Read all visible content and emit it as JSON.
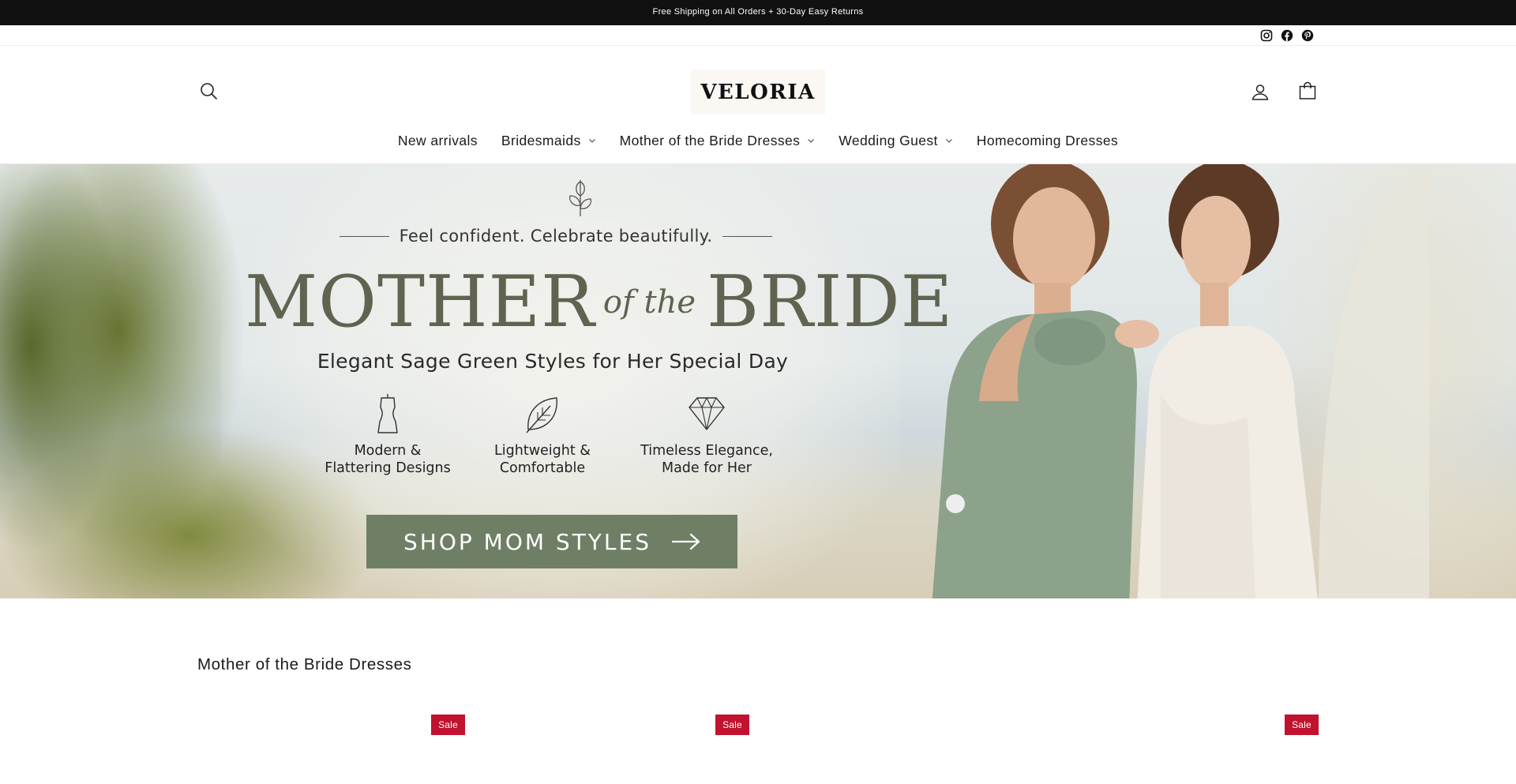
{
  "announcement": {
    "text": "Free Shipping on All Orders + 30-Day Easy Returns"
  },
  "social": [
    {
      "icon": "instagram-icon"
    },
    {
      "icon": "facebook-icon"
    },
    {
      "icon": "pinterest-icon"
    }
  ],
  "header": {
    "logo": "VELORIA",
    "search_icon": "search-icon",
    "account_icon": "account-icon",
    "cart_icon": "shopping-bag-icon"
  },
  "nav": {
    "items": [
      {
        "label": "New arrivals",
        "has_dropdown": false
      },
      {
        "label": "Bridesmaids",
        "has_dropdown": true
      },
      {
        "label": "Mother of the Bride Dresses",
        "has_dropdown": true
      },
      {
        "label": "Wedding Guest",
        "has_dropdown": true
      },
      {
        "label": "Homecoming Dresses",
        "has_dropdown": false
      }
    ]
  },
  "hero": {
    "tagline": "Feel confident. Celebrate beautifully.",
    "headline_left": "MOTHER",
    "headline_middle": "of the",
    "headline_right": "BRIDE",
    "subheading": "Elegant Sage Green Styles for Her Special Day",
    "features": [
      {
        "icon": "dress-form-icon",
        "text": "Modern &\nFlattering Designs"
      },
      {
        "icon": "leaf-icon",
        "text": "Lightweight &\nComfortable"
      },
      {
        "icon": "diamond-icon",
        "text": "Timeless Elegance,\nMade for Her"
      }
    ],
    "cta_label": "SHOP MOM STYLES",
    "accent_color": "#6f7f66",
    "headline_color": "#5f6350"
  },
  "section": {
    "title": "Mother of the Bride Dresses",
    "badges": [
      "Sale",
      "Sale",
      "Sale"
    ],
    "badge_color": "#c1122f"
  }
}
